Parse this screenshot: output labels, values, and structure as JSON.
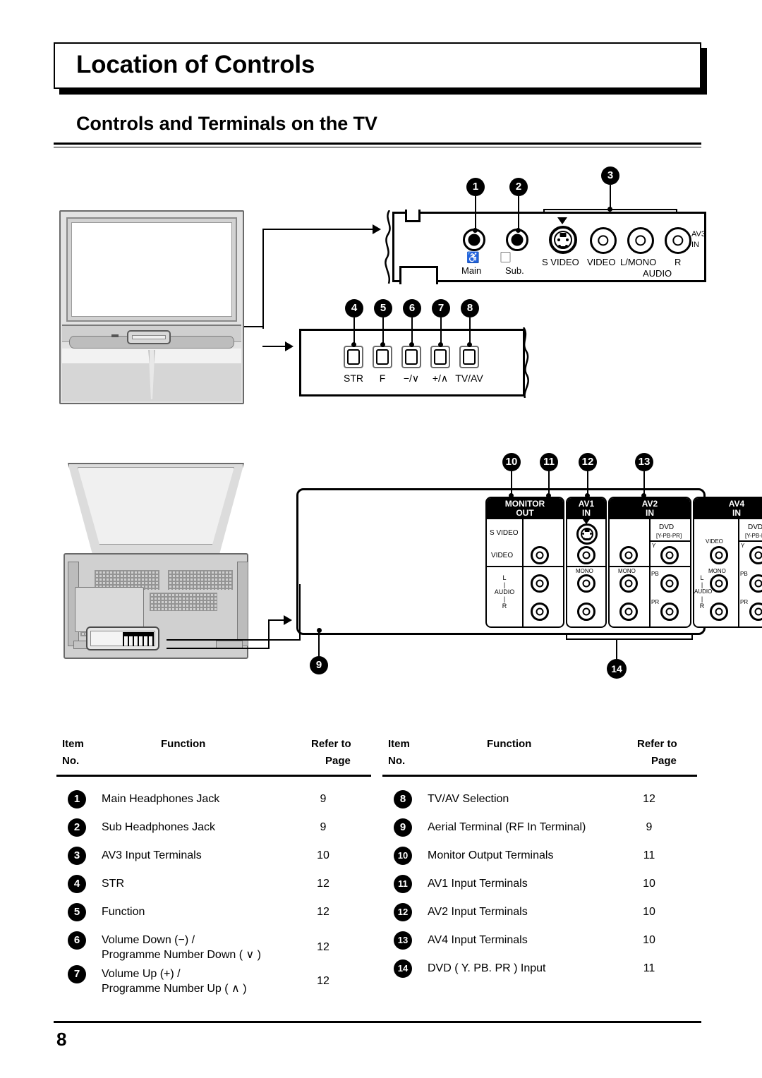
{
  "header": {
    "title": "Location of Controls",
    "subtitle": "Controls and Terminals on the TV"
  },
  "footer": {
    "page_number": "8"
  },
  "callouts": {
    "c1": "1",
    "c2": "2",
    "c3": "3",
    "c4": "4",
    "c5": "5",
    "c6": "6",
    "c7": "7",
    "c8": "8",
    "c9": "9",
    "c10": "10",
    "c11": "11",
    "c12": "12",
    "c13": "13",
    "c14": "14"
  },
  "top_panel": {
    "name": "AV3 Input Terminals panel",
    "jacks": [
      {
        "icon": "headphones-main-icon",
        "label": "Main"
      },
      {
        "icon": "headphones-sub-icon",
        "label": "Sub."
      }
    ],
    "terminals": [
      {
        "label": "S VIDEO"
      },
      {
        "label": "VIDEO"
      },
      {
        "label": "L/MONO"
      },
      {
        "label": "R"
      }
    ],
    "audio_label": "AUDIO",
    "av3_in_line1": "AV3",
    "av3_in_line2": "IN"
  },
  "button_panel": {
    "buttons": [
      {
        "label": "STR"
      },
      {
        "label": "F"
      },
      {
        "label": "−/∨"
      },
      {
        "label": "+/∧"
      },
      {
        "label": "TV/AV"
      }
    ]
  },
  "av_panel": {
    "groups": [
      {
        "head_line1": "MONITOR",
        "head_line2": "OUT",
        "row_labels": [
          "S VIDEO",
          "VIDEO"
        ],
        "audio_label": "AUDIO",
        "audio_l": "L",
        "audio_r": "R"
      },
      {
        "head_line1": "AV1",
        "head_line2": "IN",
        "mono_label": "MONO"
      },
      {
        "head_line1": "AV2",
        "head_line2": "IN",
        "mono_label": "MONO",
        "dvd_label": "DVD",
        "dvd_sub": "[Y-PB-PR]",
        "y_label": "Y",
        "pb_label": "PB",
        "pr_label": "PR"
      },
      {
        "head_line1": "AV4",
        "head_line2": "IN",
        "video_label": "VIDEO",
        "mono_label": "MONO",
        "audio_label": "AUDIO",
        "audio_l": "L",
        "audio_r": "R",
        "dvd_label": "DVD",
        "dvd_sub": "[Y-PB-PR]",
        "y_label": "Y",
        "pb_label": "PB",
        "pr_label": "PR"
      }
    ]
  },
  "tables": {
    "headers": {
      "item_line1": "Item",
      "item_line2": "No.",
      "function": "Function",
      "refer_line1": "Refer to",
      "refer_line2": "Page"
    },
    "left_rows": [
      {
        "no": "1",
        "function": "Main Headphones Jack",
        "page": "9"
      },
      {
        "no": "2",
        "function": "Sub Headphones Jack",
        "page": "9"
      },
      {
        "no": "3",
        "function": "AV3 Input Terminals",
        "page": "10"
      },
      {
        "no": "4",
        "function": "STR",
        "page": "12"
      },
      {
        "no": "5",
        "function": "Function",
        "page": "12"
      },
      {
        "no": "6",
        "function_line1": "Volume Down (−) /",
        "function_line2": "Programme Number Down ( ∨ )",
        "page": "12"
      },
      {
        "no": "7",
        "function_line1": "Volume Up (+) /",
        "function_line2": "Programme Number Up ( ∧ )",
        "page": "12"
      }
    ],
    "right_rows": [
      {
        "no": "8",
        "function": "TV/AV Selection",
        "page": "12"
      },
      {
        "no": "9",
        "function": "Aerial Terminal (RF In Terminal)",
        "page": "9"
      },
      {
        "no": "10",
        "function": "Monitor Output Terminals",
        "page": "11"
      },
      {
        "no": "11",
        "function": "AV1 Input Terminals",
        "page": "10"
      },
      {
        "no": "12",
        "function": "AV2 Input Terminals",
        "page": "10"
      },
      {
        "no": "13",
        "function": "AV4 Input Terminals",
        "page": "10"
      },
      {
        "no": "14",
        "function": "DVD ( Y. PB. PR ) Input",
        "page": "11"
      }
    ]
  }
}
